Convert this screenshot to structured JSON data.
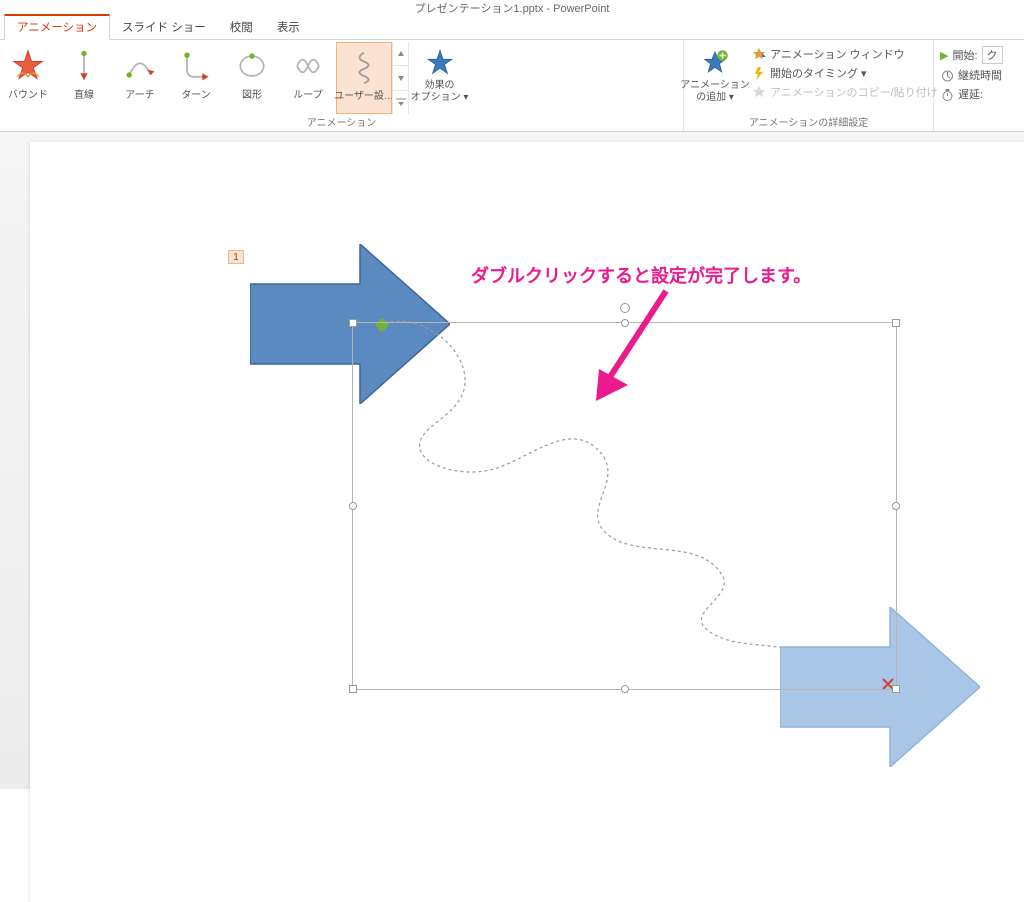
{
  "title": "プレゼンテーション1.pptx - PowerPoint",
  "tabs": {
    "animation": "アニメーション",
    "slideshow": "スライド ショー",
    "review": "校閲",
    "view": "表示"
  },
  "gallery": {
    "bound": "バウンド",
    "line": "直線",
    "arc": "アーチ",
    "turn": "ターン",
    "shape": "図形",
    "loop": "ループ",
    "custom": "ユーザー設…"
  },
  "group_labels": {
    "animation": "アニメーション",
    "advanced": "アニメーションの詳細設定"
  },
  "buttons": {
    "effect_options": "効果の\nオプション ▾",
    "add_animation": "アニメーション\nの追加 ▾"
  },
  "advanced": {
    "pane": "アニメーション ウィンドウ",
    "trigger": "開始のタイミング ▾",
    "painter": "アニメーションのコピー/貼り付け"
  },
  "timing": {
    "start_label": "開始:",
    "start_value": "ク",
    "duration_label": "継続時間",
    "delay_label": "遅延:"
  },
  "slide": {
    "anim_index": "1",
    "annotation_text": "ダブルクリックすると設定が完了します。"
  }
}
